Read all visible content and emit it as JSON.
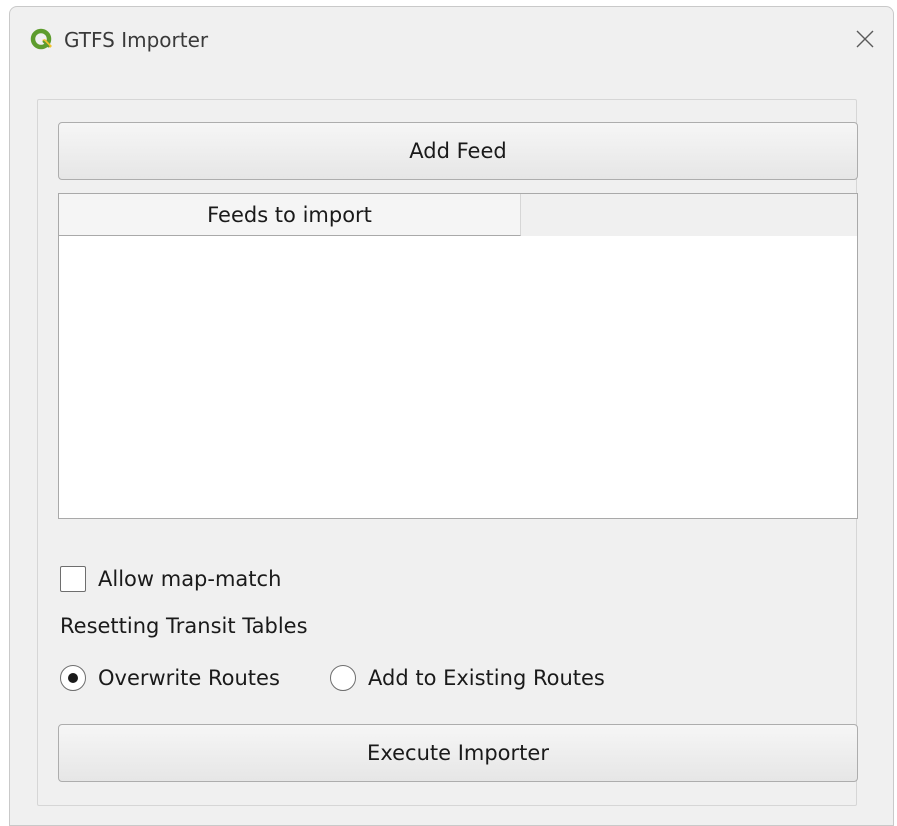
{
  "window": {
    "title": "GTFS Importer",
    "app_icon": "qgis-logo-icon",
    "close_icon": "close-icon"
  },
  "buttons": {
    "add_feed": "Add Feed",
    "execute": "Execute Importer"
  },
  "feeds_table": {
    "columns": [
      "Feeds to import"
    ],
    "rows": []
  },
  "options": {
    "allow_map_match": {
      "label": "Allow map-match",
      "checked": false
    },
    "reset_section_label": "Resetting Transit Tables",
    "reset_mode": {
      "options": [
        "Overwrite Routes",
        "Add to Existing Routes"
      ],
      "selected": "Overwrite Routes"
    }
  },
  "colors": {
    "qgis_green": "#5d9c2d",
    "qgis_yellow": "#f2c12e"
  }
}
